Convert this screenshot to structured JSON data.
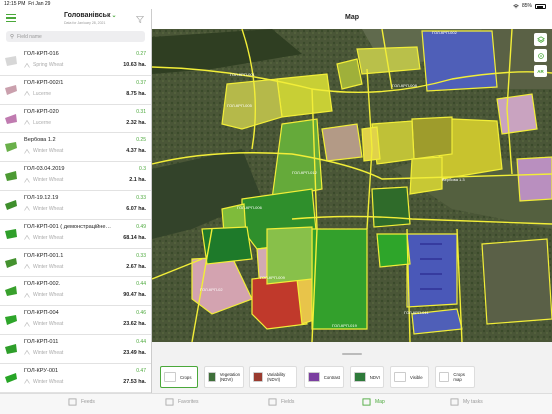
{
  "status": {
    "time": "12:15 PM",
    "date": "Fri Jan 29",
    "battery": "85%"
  },
  "sidebar": {
    "title": "Голованівськ",
    "subtitle": "Data for Jan/uary 28, 2021",
    "search_placeholder": "Field name",
    "fields": [
      {
        "name": "ГОЛ-КРП-016",
        "ndvi": "0.27",
        "crop": "Spring Wheat",
        "area": "10.63 ha.",
        "color": "#d7d7d7"
      },
      {
        "name": "ГОЛ-КРП-002/1",
        "ndvi": "0.37",
        "crop": "Lucerne",
        "area": "8.75 ha.",
        "color": "#caa0ad"
      },
      {
        "name": "ГОЛ-КРП-020",
        "ndvi": "0.31",
        "crop": "Lucerne",
        "area": "2.32 ha.",
        "color": "#c07bb0"
      },
      {
        "name": "Вербова 1.2",
        "ndvi": "0.25",
        "crop": "Winter Wheat",
        "area": "4.37 ha.",
        "color": "#6ab04a"
      },
      {
        "name": "ГОЛ-03.04.2019",
        "ndvi": "0.3",
        "crop": "Winter Wheat",
        "area": "2.1 ha.",
        "color": "#4c9a33"
      },
      {
        "name": "ГОЛ-19.12.19",
        "ndvi": "0.33",
        "crop": "Winter Wheat",
        "area": "6.07 ha.",
        "color": "#3e8f2c"
      },
      {
        "name": "ГОЛ-КРП-001 ( демонстрацiйне…",
        "ndvi": "0.49",
        "crop": "Winter Wheat",
        "area": "68.14 ha.",
        "color": "#2f9f2a"
      },
      {
        "name": "ГОЛ-КРП-001.1",
        "ndvi": "0.33",
        "crop": "Winter Wheat",
        "area": "2.67 ha.",
        "color": "#44922f"
      },
      {
        "name": "ГОЛ-КРП-002.",
        "ndvi": "0.44",
        "crop": "Winter Wheat",
        "area": "90.47 ha.",
        "color": "#38a02c"
      },
      {
        "name": "ГОЛ-КРП-004",
        "ndvi": "0.46",
        "crop": "Winter Wheat",
        "area": "23.62 ha.",
        "color": "#2ea52a"
      },
      {
        "name": "ГОЛ-КРП-011",
        "ndvi": "0.44",
        "crop": "Winter Wheat",
        "area": "23.49 ha.",
        "color": "#2e9e2a"
      },
      {
        "name": "ГОЛ-КРУ-001",
        "ndvi": "0.47",
        "crop": "Winter Wheat",
        "area": "27.53 ha.",
        "color": "#27a526"
      }
    ]
  },
  "map": {
    "title": "Map",
    "controls": {
      "ar_label": "AR"
    },
    "field_labels": [
      "ГОЛ-КРП-001",
      "ГОЛ-КРП-006",
      "ГОЛ-КРП-012",
      "ГОЛ-КРП-005",
      "ГОЛ-КРП-02",
      "ГОЛ-КРП-002",
      "ГОЛ-КРП-011",
      "ГОЛ-КРП-019",
      "ГОЛ-КРП-009",
      "ГОЛ-КРП-008",
      "Вербова 1.3"
    ]
  },
  "layers": [
    {
      "label": "Crops",
      "color": "#ffffff",
      "active": true
    },
    {
      "label": "Vegetation (NDVI)",
      "color": "#3f6f3a",
      "active": false
    },
    {
      "label": "Variability (NDVI)",
      "color": "#9a3b2f",
      "active": false
    },
    {
      "label": "Contrast",
      "color": "#7b3fa0",
      "active": false
    },
    {
      "label": "NDVI",
      "color": "#2e7a3a",
      "active": false
    },
    {
      "label": "Visible",
      "color": "#ffffff",
      "active": false
    },
    {
      "label": "Crops map",
      "color": "#ffffff",
      "active": false
    }
  ],
  "tabs": [
    {
      "label": "Feeds",
      "active": false
    },
    {
      "label": "Favorites",
      "active": false
    },
    {
      "label": "Fields",
      "active": false
    },
    {
      "label": "Map",
      "active": true
    },
    {
      "label": "My tasks",
      "active": false
    }
  ]
}
